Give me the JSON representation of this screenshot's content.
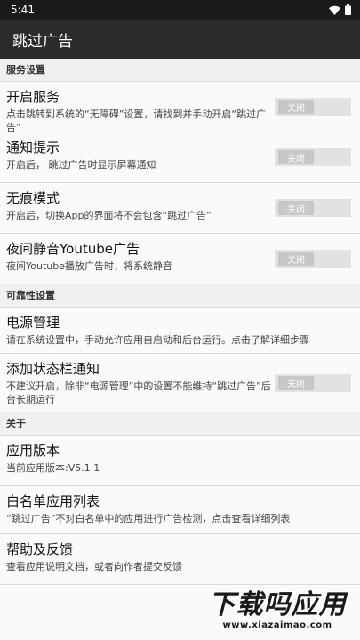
{
  "status_bar": {
    "time": "5:41"
  },
  "app_bar": {
    "title": "跳过广告"
  },
  "sections": {
    "service": {
      "header": "服务设置",
      "items": [
        {
          "title": "开启服务",
          "summary": "点击跳转到系统的“无障碍”设置，请找到并手动开启“跳过广告”",
          "switch": "关闭"
        },
        {
          "title": "通知提示",
          "summary": "开启后， 跳过广告时显示屏幕通知",
          "switch": "关闭"
        },
        {
          "title": "无痕模式",
          "summary": "开启后，切换App的界面将不会包含“跳过广告”",
          "switch": "关闭"
        },
        {
          "title": "夜间静音Youtube广告",
          "summary": "夜间Youtube播放广告时，将系统静音",
          "switch": "关闭"
        }
      ]
    },
    "reliability": {
      "header": "可靠性设置",
      "items": [
        {
          "title": "电源管理",
          "summary": "请在系统设置中，手动允许应用自启动和后台运行。点击了解详细步骤"
        },
        {
          "title": "添加状态栏通知",
          "summary": "不建议开启，除非“电源管理”中的设置不能维持“跳过广告”后台长期运行",
          "switch": "关闭"
        }
      ]
    },
    "about": {
      "header": "关于",
      "items": [
        {
          "title": "应用版本",
          "summary": "当前应用版本:V5.1.1"
        },
        {
          "title": "白名单应用列表",
          "summary": "“跳过广告”不对白名单中的应用进行广告检测，点击查看详细列表"
        },
        {
          "title": "帮助及反馈",
          "summary": "查看应用说明文档，或者向作者提交反馈"
        }
      ]
    }
  },
  "watermark": {
    "main": "下载吗应用",
    "url": "www.xiazaimao.com"
  }
}
